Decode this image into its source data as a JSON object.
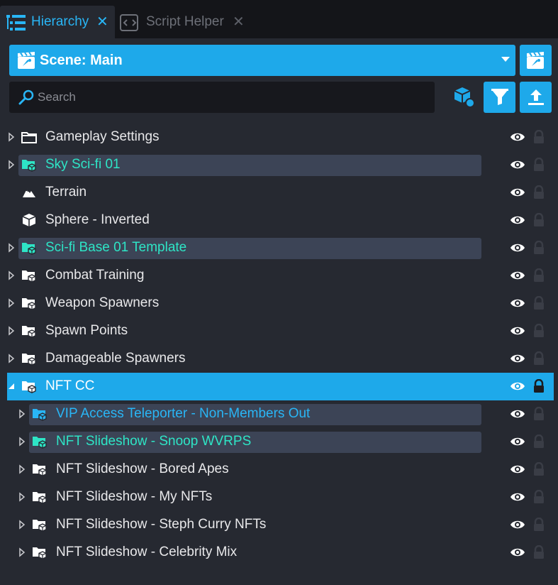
{
  "tabs": [
    {
      "label": "Hierarchy",
      "active": true
    },
    {
      "label": "Script Helper",
      "active": false
    }
  ],
  "scene": {
    "label": "Scene: Main"
  },
  "search": {
    "placeholder": "Search",
    "value": ""
  },
  "colors": {
    "accent": "#1ea9ea",
    "template_text": "#2ee5c6",
    "template_selected_text": "#29b6f6",
    "template_bg": "#3c4456",
    "panel_bg": "#262931",
    "normal_text": "#e8e8ea"
  },
  "rows": [
    {
      "label": "Gameplay Settings",
      "icon": "folder-icon",
      "expandable": true,
      "expanded": false,
      "indent": 0,
      "template": false,
      "selected": false
    },
    {
      "label": "Sky Sci-fi 01",
      "icon": "template-folder-icon",
      "expandable": true,
      "expanded": false,
      "indent": 0,
      "template": true,
      "selected": false
    },
    {
      "label": "Terrain",
      "icon": "terrain-icon",
      "expandable": false,
      "expanded": false,
      "indent": 0,
      "template": false,
      "selected": false
    },
    {
      "label": "Sphere - Inverted",
      "icon": "cube-icon",
      "expandable": false,
      "expanded": false,
      "indent": 0,
      "template": false,
      "selected": false
    },
    {
      "label": "Sci-fi Base 01 Template",
      "icon": "template-folder-icon",
      "expandable": true,
      "expanded": false,
      "indent": 0,
      "template": true,
      "selected": false
    },
    {
      "label": "Combat Training",
      "icon": "group-folder-icon",
      "expandable": true,
      "expanded": false,
      "indent": 0,
      "template": false,
      "selected": false
    },
    {
      "label": "Weapon Spawners",
      "icon": "group-folder-icon",
      "expandable": true,
      "expanded": false,
      "indent": 0,
      "template": false,
      "selected": false
    },
    {
      "label": "Spawn Points",
      "icon": "group-folder-icon",
      "expandable": true,
      "expanded": false,
      "indent": 0,
      "template": false,
      "selected": false
    },
    {
      "label": "Damageable Spawners",
      "icon": "group-folder-icon",
      "expandable": true,
      "expanded": false,
      "indent": 0,
      "template": false,
      "selected": false
    },
    {
      "label": "NFT CC",
      "icon": "group-folder-icon",
      "expandable": true,
      "expanded": true,
      "indent": 0,
      "template": false,
      "selected": true
    },
    {
      "label": "VIP Access Teleporter - Non-Members Out",
      "icon": "template-folder-icon",
      "expandable": true,
      "expanded": false,
      "indent": 1,
      "template": true,
      "selected": false,
      "template_color": "blue"
    },
    {
      "label": "NFT Slideshow - Snoop WVRPS",
      "icon": "template-folder-icon",
      "expandable": true,
      "expanded": false,
      "indent": 1,
      "template": true,
      "selected": false
    },
    {
      "label": "NFT Slideshow - Bored Apes",
      "icon": "group-folder-icon",
      "expandable": true,
      "expanded": false,
      "indent": 1,
      "template": false,
      "selected": false
    },
    {
      "label": "NFT Slideshow - My NFTs",
      "icon": "group-folder-icon",
      "expandable": true,
      "expanded": false,
      "indent": 1,
      "template": false,
      "selected": false
    },
    {
      "label": "NFT Slideshow - Steph Curry NFTs",
      "icon": "group-folder-icon",
      "expandable": true,
      "expanded": false,
      "indent": 1,
      "template": false,
      "selected": false
    },
    {
      "label": "NFT Slideshow - Celebrity Mix",
      "icon": "group-folder-icon",
      "expandable": true,
      "expanded": false,
      "indent": 1,
      "template": false,
      "selected": false
    }
  ]
}
